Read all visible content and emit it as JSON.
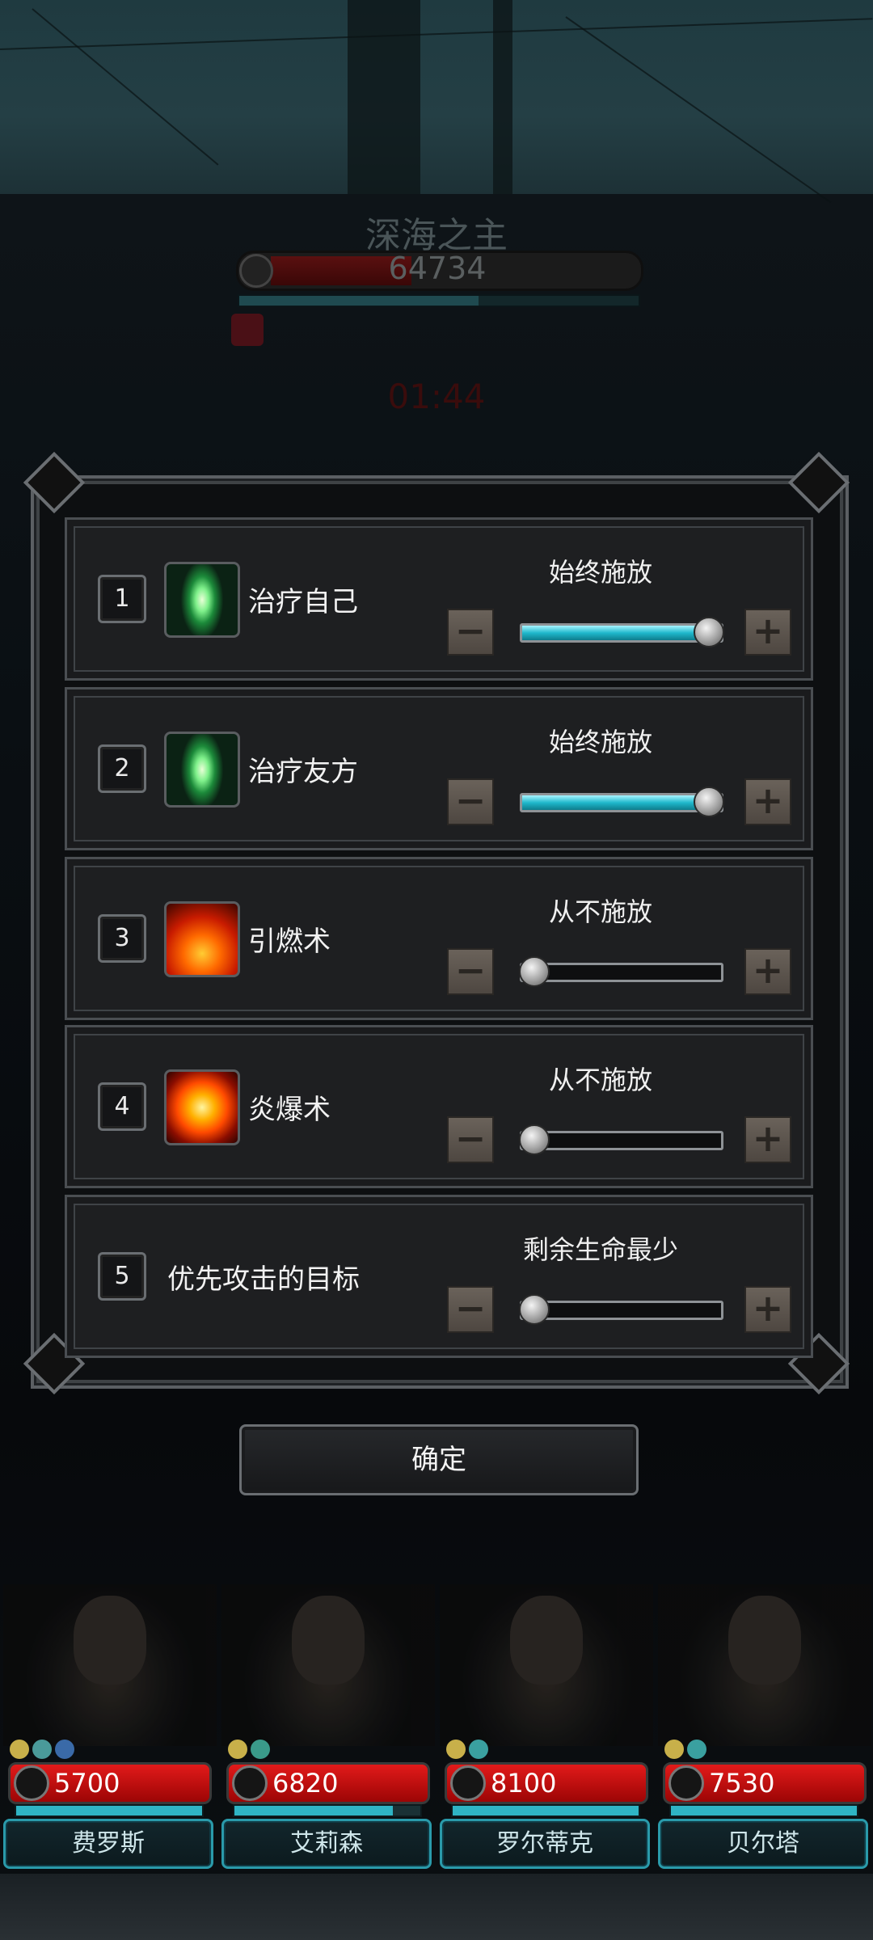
{
  "boss": {
    "name": "深海之主",
    "hp": "64734",
    "hp_fraction": 0.35,
    "energy_fraction": 0.6
  },
  "timer": "01:44",
  "settings": [
    {
      "index": "1",
      "icon": "heal-crystal-icon",
      "name": "治疗自己",
      "mode": "始终施放",
      "level": 1.0
    },
    {
      "index": "2",
      "icon": "heal-crystal-icon",
      "name": "治疗友方",
      "mode": "始终施放",
      "level": 1.0
    },
    {
      "index": "3",
      "icon": "ignite-fire-icon",
      "name": "引燃术",
      "mode": "从不施放",
      "level": 0.0
    },
    {
      "index": "4",
      "icon": "flame-blast-icon",
      "name": "炎爆术",
      "mode": "从不施放",
      "level": 0.0
    },
    {
      "index": "5",
      "icon": "",
      "name": "优先攻击的目标",
      "mode": "剩余生命最少",
      "level": 0.0
    }
  ],
  "confirm_label": "确定",
  "heroes": [
    {
      "name": "费罗斯",
      "hp": "5700",
      "energy_fraction": 1.0
    },
    {
      "name": "艾莉森",
      "hp": "6820",
      "energy_fraction": 0.85
    },
    {
      "name": "罗尔蒂克",
      "hp": "8100",
      "energy_fraction": 1.0
    },
    {
      "name": "贝尔塔",
      "hp": "7530",
      "energy_fraction": 1.0
    }
  ],
  "colors": {
    "slider_fill": "#1fb8cc",
    "hp_bar": "#c40f0f",
    "name_plate_border": "#2a9aaa"
  }
}
